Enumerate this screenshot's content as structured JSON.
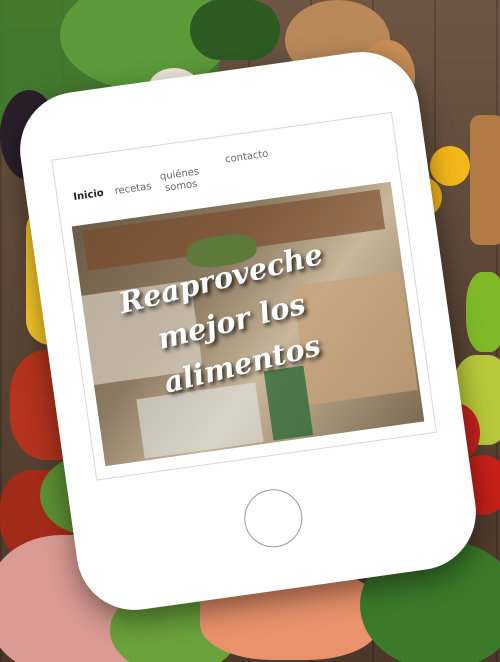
{
  "nav": {
    "items": [
      {
        "label": "Inicio",
        "active": true
      },
      {
        "label": "recetas",
        "active": false
      },
      {
        "label": "quiénes\nsomos",
        "active": false
      },
      {
        "label": "contacto",
        "active": false
      }
    ]
  },
  "hero": {
    "line1": "Reaproveche",
    "line2": "mejor los",
    "line3": "alimentos"
  },
  "colors": {
    "phone": "#ffffff",
    "wood": "#5b4636"
  }
}
